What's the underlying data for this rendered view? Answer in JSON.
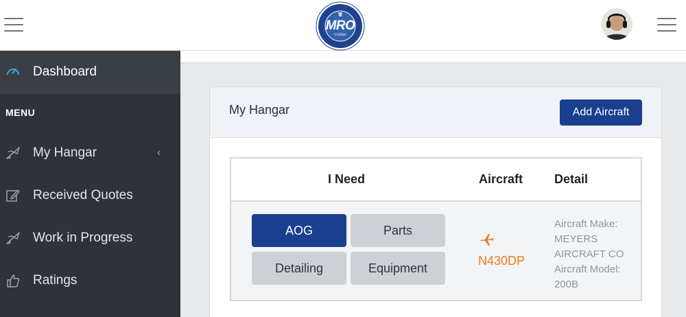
{
  "header": {
    "logo": {
      "text": "MRO",
      "sub": "insider",
      "ring_top": "MAINTENANCE",
      "ring_bottom": "QUOTES . DELIVERED"
    },
    "avatar_alt": "user avatar"
  },
  "sidebar": {
    "dashboard": {
      "label": "Dashboard",
      "icon": "dashboard-gauge-icon"
    },
    "menu_header": "MENU",
    "items": [
      {
        "label": "My Hangar",
        "icon": "plane-icon",
        "has_chevron": true
      },
      {
        "label": "Received Quotes",
        "icon": "edit-icon"
      },
      {
        "label": "Work in Progress",
        "icon": "plane-icon"
      },
      {
        "label": "Ratings",
        "icon": "thumbs-up-icon"
      }
    ]
  },
  "card": {
    "title": "My Hangar",
    "add_button": "Add Aircraft"
  },
  "table": {
    "columns": [
      "I Need",
      "Aircraft",
      "Detail"
    ],
    "row": {
      "needs": [
        "AOG",
        "Parts",
        "Detailing",
        "Equipment"
      ],
      "tail_number": "N430DP",
      "detail_lines": [
        "Aircraft Make:",
        "MEYERS",
        "AIRCRAFT CO",
        "Aircraft Model:",
        "200B"
      ]
    }
  },
  "colors": {
    "primary": "#1a3f8f",
    "sidebar": "#2f3339",
    "accent_orange": "#ee7a1f",
    "dashboard_icon": "#3aa7d6"
  }
}
